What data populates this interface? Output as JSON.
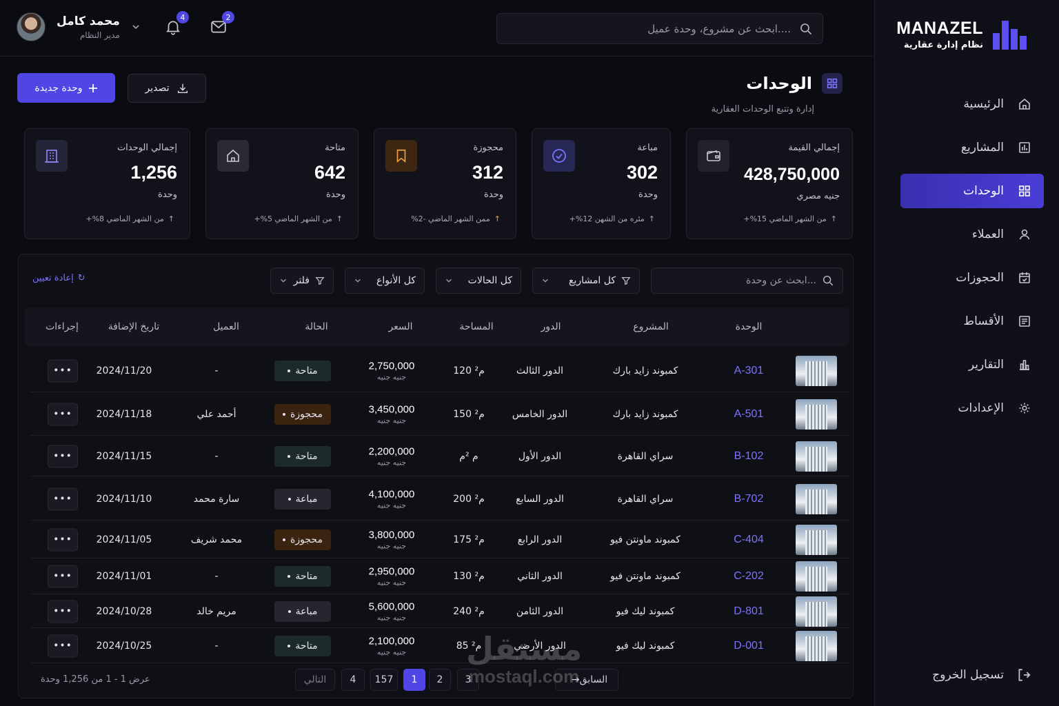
{
  "brand": {
    "name": "MANAZEL",
    "subtitle": "نظام إدارة عقارية"
  },
  "colors": {
    "accent": "#4f46e5",
    "link": "#7b74ff",
    "orange": "#f0a24a",
    "background": "#0b0b12"
  },
  "nav": {
    "items": [
      {
        "label": "الرئيسية",
        "icon": "home-icon",
        "active": false
      },
      {
        "label": "المشاريع",
        "icon": "projects-icon",
        "active": false
      },
      {
        "label": "الوحدات",
        "icon": "grid-icon",
        "active": true
      },
      {
        "label": "العملاء",
        "icon": "user-icon",
        "active": false
      },
      {
        "label": "الحجوزات",
        "icon": "calendar-icon",
        "active": false
      },
      {
        "label": "الأقساط",
        "icon": "invoice-icon",
        "active": false
      },
      {
        "label": "التقارير",
        "icon": "bar-chart-icon",
        "active": false
      },
      {
        "label": "الإعدادات",
        "icon": "gear-icon",
        "active": false
      }
    ],
    "logout": "تسجيل الخروج"
  },
  "header": {
    "search_placeholder": "ابحث عن مشروع، وحدة عميل....",
    "notifications_count": "4",
    "messages_count": "2",
    "user_name": "محمد كامل",
    "user_role": "مدير النظام"
  },
  "page": {
    "title": "الوحدات",
    "subtitle": "إدارة وتتبع الوحدات العقارية",
    "new_button": "وحدة جديدة",
    "export_button": "تصدير"
  },
  "stats": [
    {
      "label": "إجمالي القيمة",
      "value": "428,750,000",
      "unit": "جنيه مصري",
      "trend": "من الشهر الماضي 15%+",
      "icon": "wallet-icon"
    },
    {
      "label": "مباعة",
      "value": "302",
      "unit": "وحدة",
      "trend": "مئره من الشهن 12%+",
      "icon": "check-circle-icon"
    },
    {
      "label": "محجوزة",
      "value": "312",
      "unit": "وحدة",
      "trend": "ممن الشهر الماضي -2%",
      "icon": "bookmark-icon"
    },
    {
      "label": "متاحة",
      "value": "642",
      "unit": "وحدة",
      "trend": "من الشهر الماضي 5%+",
      "icon": "house-icon"
    },
    {
      "label": "إجمالي الوحدات",
      "value": "1,256",
      "unit": "وحدة",
      "trend": "من الشهر الماضي 8%+",
      "icon": "building-icon"
    }
  ],
  "filters": {
    "search_placeholder": "ابحث عن وحدة...",
    "projects": "كل امشاريع",
    "statuses": "كل الحالات",
    "types": "كل الأنواع",
    "filter": "فلتر",
    "reset": "إعادة تعيين"
  },
  "table": {
    "headers": {
      "unit": "الوحدة",
      "project": "المشروع",
      "floor": "الدور",
      "area": "المساحة",
      "price": "السعر",
      "status": "الحالة",
      "client": "العميل",
      "date": "تاريخ الإضافة",
      "actions": "إجراءات"
    },
    "rows": [
      {
        "unit": "A-301",
        "project": "كمبوند زايد بارك",
        "floor": "الدور الثالث",
        "area": "120 م²",
        "price": "2,750,000",
        "currency": "جنيه جنيه",
        "status": "متاحة",
        "status_kind": "green",
        "client": "-",
        "date": "2024/11/20",
        "actions": "•••"
      },
      {
        "unit": "A-501",
        "project": "كمبوند زايد بارك",
        "floor": "الدور الخامس",
        "area": "150 م²",
        "price": "3,450,000",
        "currency": "جنيه جنيه",
        "status": "محجوزة",
        "status_kind": "orange",
        "client": "أحمد علي",
        "date": "2024/11/18",
        "actions": "•••"
      },
      {
        "unit": "B-102",
        "project": "سراي القاهرة",
        "floor": "الدور الأول",
        "area": "م ²م",
        "price": "2,200,000",
        "currency": "جنيه جنيه",
        "status": "متاحة",
        "status_kind": "green",
        "client": "-",
        "date": "2024/11/15",
        "actions": "•••"
      },
      {
        "unit": "B-702",
        "project": "سراي القاهرة",
        "floor": "الدور السابع",
        "area": "200 م²",
        "price": "4,100,000",
        "currency": "جنيه جنيه",
        "status": "مباعة",
        "status_kind": "gray",
        "client": "سارة محمد",
        "date": "2024/11/10",
        "actions": "•••"
      },
      {
        "unit": "C-404",
        "project": "كمبوند ماونتن فيو",
        "floor": "الدور الرابع",
        "area": "175 م²",
        "price": "3,800,000",
        "currency": "جنيه جنيه",
        "status": "محجوزة",
        "status_kind": "orange",
        "client": "محمد شريف",
        "date": "2024/11/05",
        "actions": "•••"
      },
      {
        "unit": "C-202",
        "project": "كمبوند ماونتن فيو",
        "floor": "الدور الثاني",
        "area": "130 م²",
        "price": "2,950,000",
        "currency": "جنيه جنيه",
        "status": "متاحة",
        "status_kind": "green",
        "client": "-",
        "date": "2024/11/01",
        "actions": "•••"
      },
      {
        "unit": "D-801",
        "project": "كمبوند ليك فيو",
        "floor": "الدور الثامن",
        "area": "240 م²",
        "price": "5,600,000",
        "currency": "جنيه جنيه",
        "status": "مباعة",
        "status_kind": "gray",
        "client": "مريم خالد",
        "date": "2024/10/28",
        "actions": "•••"
      },
      {
        "unit": "D-001",
        "project": "كمبوند ليك فيو",
        "floor": "الدور الأرضي",
        "area": "85 م²",
        "price": "2,100,000",
        "currency": "جنيه جنيه",
        "status": "متاحة",
        "status_kind": "green",
        "client": "-",
        "date": "2024/10/25",
        "actions": "•••"
      }
    ]
  },
  "pagination": {
    "summary": "عرض 1 - 1 من 1,256 وحدة",
    "next": "التالي",
    "prev": "السابق",
    "pages": [
      "4",
      "157",
      "1",
      "2",
      "3"
    ]
  },
  "watermark": {
    "arabic": "مستقل",
    "latin": "mostaql.com"
  }
}
